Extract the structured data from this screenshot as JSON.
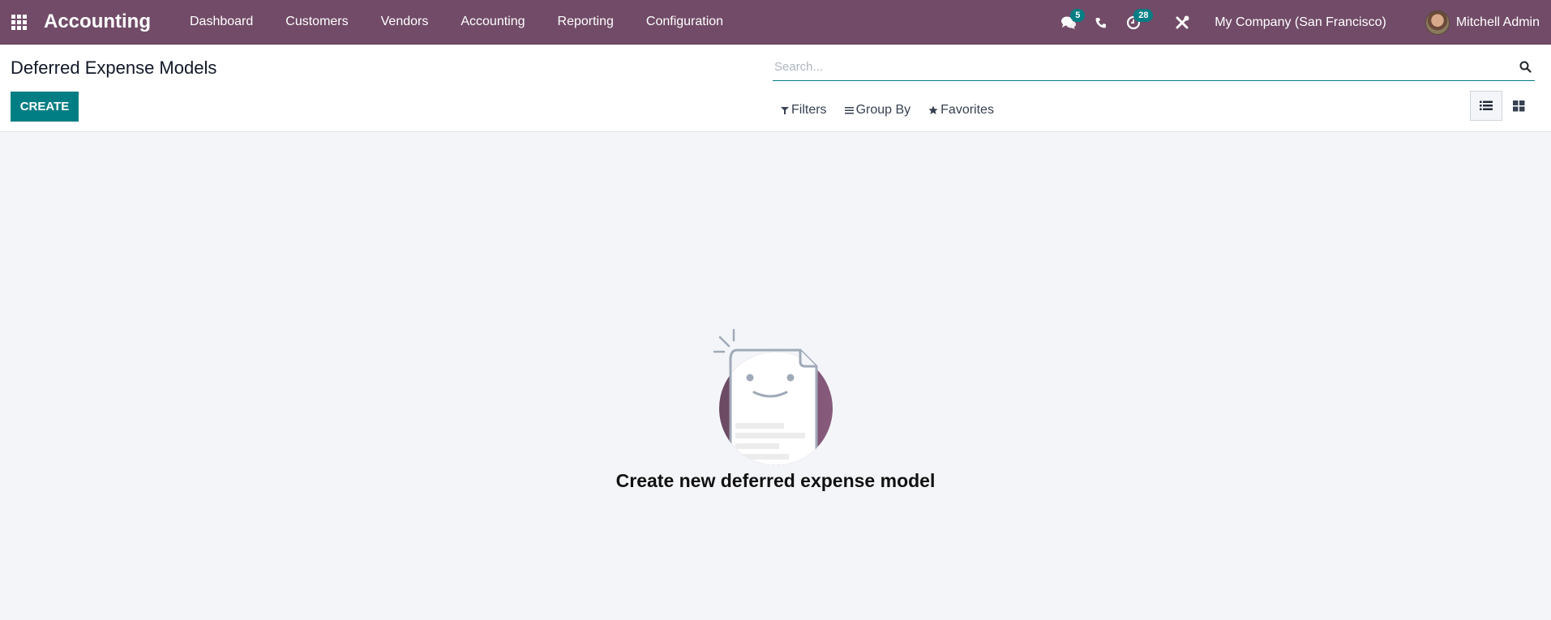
{
  "navbar": {
    "apps_icon": "apps-grid-icon",
    "brand": "Accounting",
    "menu": [
      {
        "label": "Dashboard"
      },
      {
        "label": "Customers"
      },
      {
        "label": "Vendors"
      },
      {
        "label": "Accounting"
      },
      {
        "label": "Reporting"
      },
      {
        "label": "Configuration"
      }
    ],
    "systray": {
      "messages_badge": "5",
      "activities_badge": "28",
      "company": "My Company (San Francisco)",
      "user": "Mitchell Admin"
    },
    "colors": {
      "bar": "#714b67",
      "badge": "#017e84"
    }
  },
  "control_panel": {
    "title": "Deferred Expense Models",
    "create_label": "CREATE",
    "search_placeholder": "Search...",
    "filters_label": "Filters",
    "groupby_label": "Group By",
    "favorites_label": "Favorites",
    "views": [
      {
        "name": "list",
        "active": true
      },
      {
        "name": "kanban",
        "active": false
      }
    ],
    "accent": "#017e84"
  },
  "empty_state": {
    "title": "Create new deferred expense model"
  }
}
